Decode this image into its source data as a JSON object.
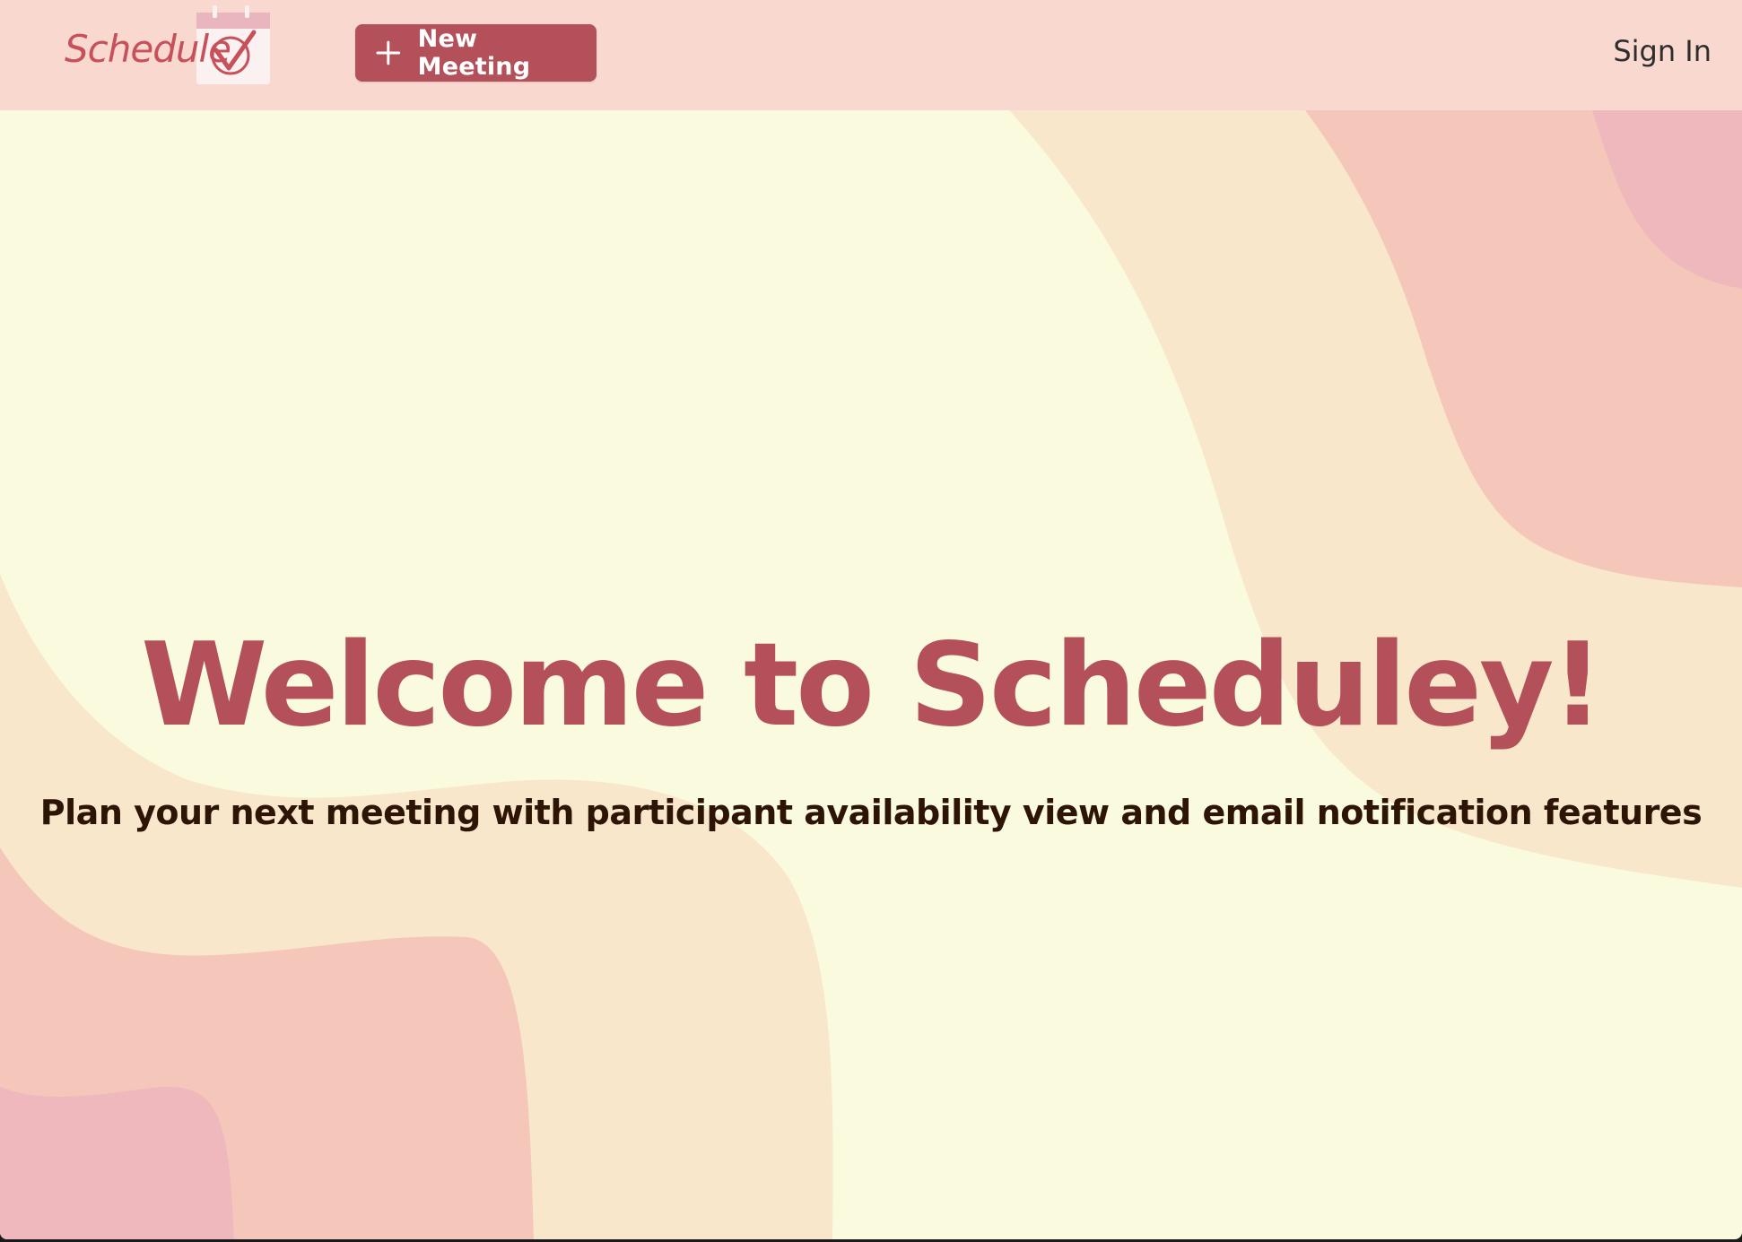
{
  "app": {
    "logo_text": "Schedule",
    "brand_color": "#b4505a",
    "navbar_bg": "#f9d9cf",
    "page_bg": "#fafadf"
  },
  "navbar": {
    "new_meeting_label": "New Meeting",
    "new_meeting_icon": "plus-icon",
    "sign_in_label": "Sign In"
  },
  "hero": {
    "title": "Welcome to Scheduley!",
    "subtitle": "Plan your next meeting with participant availability view and email notification features"
  },
  "background": {
    "wave_colors": [
      "#f8e7cb",
      "#f5c6ba",
      "#efb8bc"
    ]
  }
}
